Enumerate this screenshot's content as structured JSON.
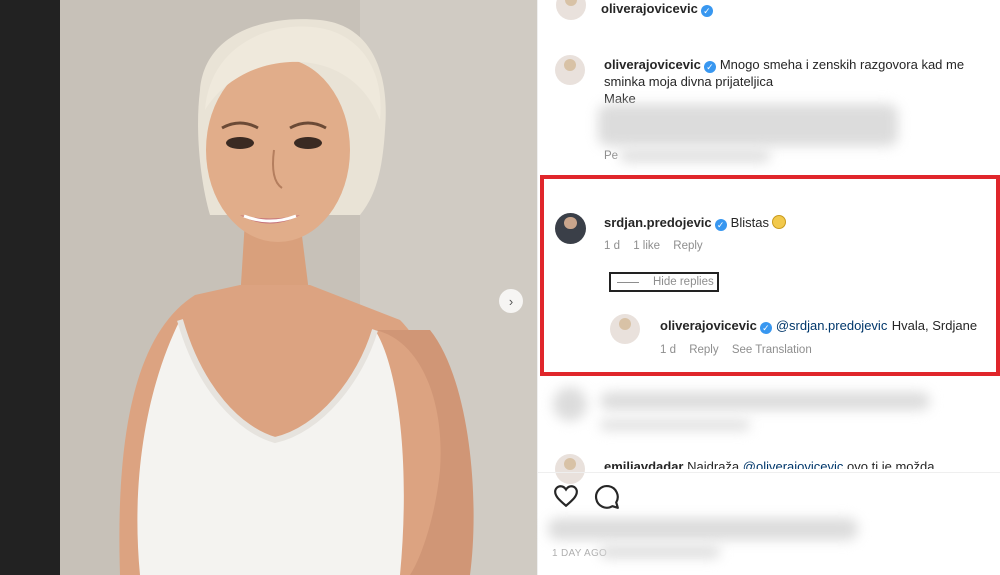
{
  "header": {
    "username": "oliverajovicevic"
  },
  "caption": {
    "username": "oliverajovicevic",
    "text_line1": "Mnogo smeha i zenskih razgovora kad me",
    "text_line2": "sminka moja divna prijateljica",
    "text_line3": "Make",
    "partial_link": "Pe"
  },
  "comment": {
    "username": "srdjan.predojevic",
    "text": "Blistas",
    "time": "1 d",
    "likes": "1 like",
    "reply": "Reply"
  },
  "hide_replies_label": "Hide replies",
  "reply": {
    "username": "oliverajovicevic",
    "mention": "@srdjan.predojevic",
    "text": "Hvala, Srdjane",
    "time": "1 d",
    "reply": "Reply",
    "translation": "See Translation"
  },
  "partial_comment": {
    "username": "emiliavdadar",
    "text": "Najdraža",
    "mention": "@oliverajovicevic",
    "tail": "ovo ti je možda"
  },
  "footer": {
    "time_partial": "1 DAY AGO"
  },
  "colors": {
    "highlight": "#e0262b",
    "verified": "#3897f0",
    "link": "#00376b"
  }
}
